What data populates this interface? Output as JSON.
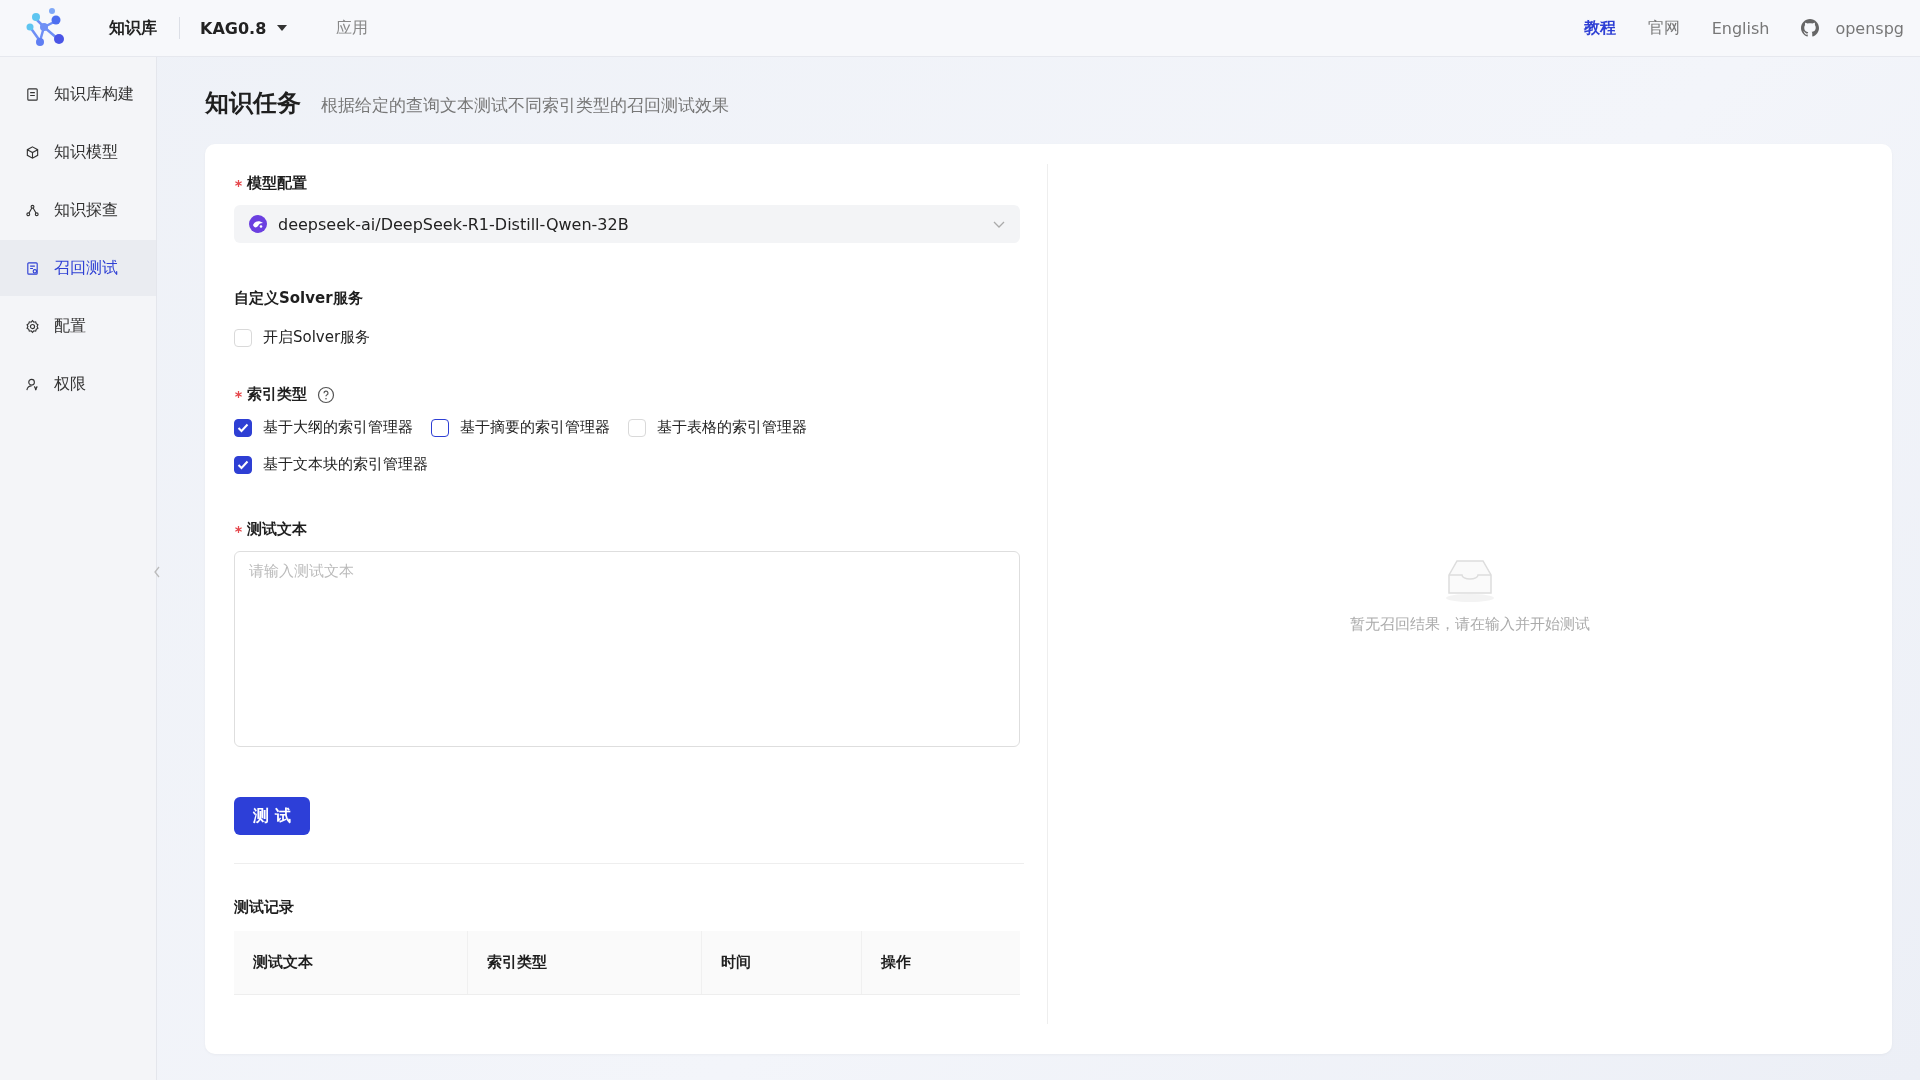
{
  "header": {
    "brand": "知识库",
    "version_select": "KAG0.8",
    "nav_link": "应用",
    "right_links": [
      {
        "label": "教程",
        "selected": true
      },
      {
        "label": "官网",
        "selected": false
      },
      {
        "label": "English",
        "selected": false
      }
    ],
    "github_label": "openspg"
  },
  "sidebar": {
    "items": [
      {
        "label": "知识库构建",
        "kind": "doc",
        "selected": false
      },
      {
        "label": "知识模型",
        "kind": "cube",
        "selected": false
      },
      {
        "label": "知识探查",
        "kind": "graph",
        "selected": false
      },
      {
        "label": "召回测试",
        "kind": "test",
        "selected": true
      },
      {
        "label": "配置",
        "kind": "gear",
        "selected": false
      },
      {
        "label": "权限",
        "kind": "user",
        "selected": false
      }
    ]
  },
  "page": {
    "title": "知识任务",
    "subtitle": "根据给定的查询文本测试不同索引类型的召回测试效果"
  },
  "form": {
    "model": {
      "label": "模型配置",
      "required": true,
      "value": "deepseek-ai/DeepSeek-R1-Distill-Qwen-32B"
    },
    "solver": {
      "label": "自定义Solver服务",
      "required": false,
      "checkbox": {
        "label": "开启Solver服务",
        "checked": false,
        "hovered": false
      }
    },
    "index_type": {
      "label": "索引类型",
      "required": true,
      "options": [
        {
          "label": "基于大纲的索引管理器",
          "checked": true,
          "hovered": false
        },
        {
          "label": "基于摘要的索引管理器",
          "checked": false,
          "hovered": true
        },
        {
          "label": "基于表格的索引管理器",
          "checked": false,
          "hovered": false
        },
        {
          "label": "基于文本块的索引管理器",
          "checked": true,
          "hovered": false
        }
      ]
    },
    "test_text": {
      "label": "测试文本",
      "required": true,
      "placeholder": "请输入测试文本"
    },
    "submit_button": "测 试",
    "records": {
      "title": "测试记录",
      "columns": [
        "测试文本",
        "索引类型",
        "时间",
        "操作"
      ]
    }
  },
  "results": {
    "empty_text": "暂无召回结果，请在输入并开始测试"
  }
}
